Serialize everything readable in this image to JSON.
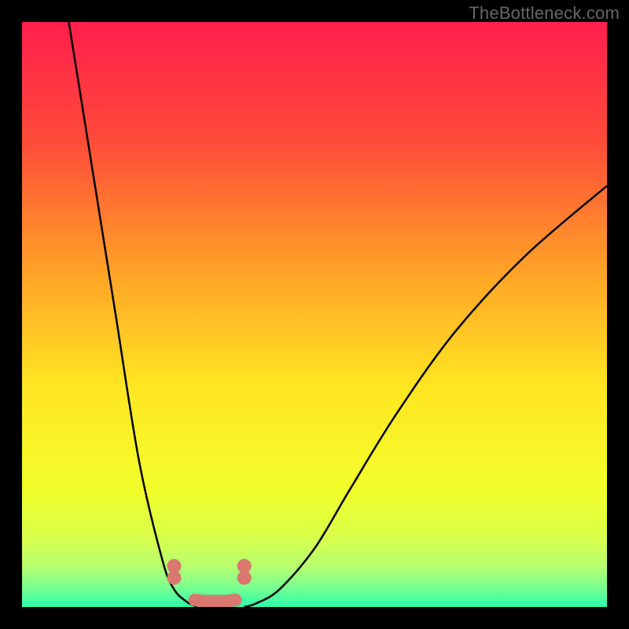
{
  "watermark": "TheBottleneck.com",
  "chart_data": {
    "type": "line",
    "title": "",
    "xlabel": "",
    "ylabel": "",
    "xlim": [
      0,
      100
    ],
    "ylim": [
      0,
      100
    ],
    "grid": false,
    "legend": false,
    "series": [
      {
        "name": "curve-left",
        "x": [
          8,
          12,
          16,
          20,
          24,
          26,
          28,
          29,
          30
        ],
        "values": [
          100,
          75,
          50,
          25,
          8,
          3,
          1,
          0.4,
          0
        ],
        "color": "#000000",
        "marker": false
      },
      {
        "name": "curve-right",
        "x": [
          38,
          40,
          44,
          50,
          56,
          64,
          74,
          86,
          100
        ],
        "values": [
          0,
          0.6,
          3,
          10,
          20,
          33,
          47,
          60,
          72
        ],
        "color": "#000000",
        "marker": false
      },
      {
        "name": "markers-bottom",
        "x": [
          26,
          26,
          29.5,
          31,
          33,
          35,
          36.5,
          38,
          38
        ],
        "values": [
          7,
          5,
          1.2,
          1.0,
          1.0,
          1.0,
          1.2,
          5,
          7
        ],
        "color": "#d8786f",
        "marker": true
      }
    ],
    "gradient": {
      "stops": [
        {
          "offset": 0.0,
          "color": "#ff1f4c"
        },
        {
          "offset": 0.2,
          "color": "#ff4a3a"
        },
        {
          "offset": 0.42,
          "color": "#ffa027"
        },
        {
          "offset": 0.62,
          "color": "#ffe521"
        },
        {
          "offset": 0.8,
          "color": "#f2ff2a"
        },
        {
          "offset": 0.88,
          "color": "#d9ff4a"
        },
        {
          "offset": 0.93,
          "color": "#b8ff6e"
        },
        {
          "offset": 0.965,
          "color": "#7dff8f"
        },
        {
          "offset": 1.0,
          "color": "#2bffab"
        }
      ]
    }
  }
}
